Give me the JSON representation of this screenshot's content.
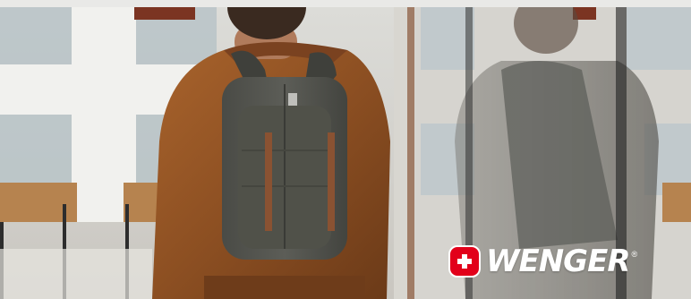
{
  "brand": {
    "name": "WENGER",
    "registered_mark": "®",
    "accent_color": "#e2001a"
  },
  "photo": {
    "icon": "swiss-cross-icon"
  }
}
